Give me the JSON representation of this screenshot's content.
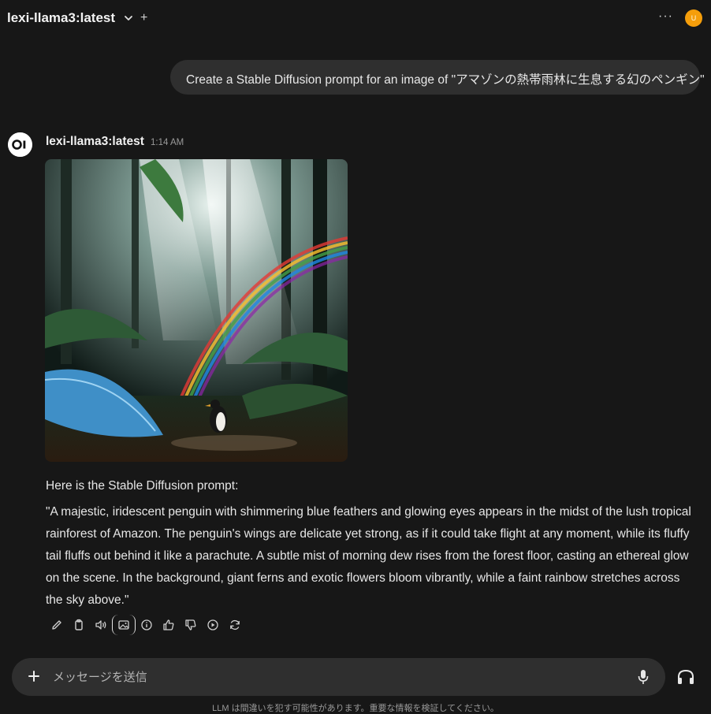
{
  "header": {
    "model_name": "lexi-llama3:latest",
    "new_chat_icon": "plus-icon",
    "menu_icon": "ellipsis-icon",
    "user_avatar_initial": "U",
    "user_avatar_color": "#f59e0b"
  },
  "user_message": {
    "text": "Create a Stable Diffusion prompt for an image of \"アマゾンの熱帯雨林に生息する幻のペンギン\""
  },
  "assistant_message": {
    "model_name": "lexi-llama3:latest",
    "time": "1:14 AM",
    "image_alt": "Penguin in Amazon rainforest with rainbow and sunbeams",
    "intro": "Here is the Stable Diffusion prompt:",
    "prompt": "\"A majestic, iridescent penguin with shimmering blue feathers and glowing eyes appears in the midst of the lush tropical rainforest of Amazon. The penguin's wings are delicate yet strong, as if it could take flight at any moment, while its fluffy tail fluffs out behind it like a parachute. A subtle mist of morning dew rises from the forest floor, casting an ethereal glow on the scene. In the background, giant ferns and exotic flowers bloom vibrantly, while a faint rainbow stretches across the sky above.\"",
    "actions": [
      "edit-icon",
      "copy-icon",
      "read-aloud-icon",
      "generate-image-icon",
      "info-icon",
      "thumbs-up-icon",
      "thumbs-down-icon",
      "continue-icon",
      "regenerate-icon"
    ]
  },
  "composer": {
    "placeholder": "メッセージを送信",
    "disclaimer": "LLM は間違いを犯す可能性があります。重要な情報を検証してください。"
  },
  "colors": {
    "background": "#171717",
    "bubble": "#2f2f2f",
    "text": "#ececec"
  }
}
